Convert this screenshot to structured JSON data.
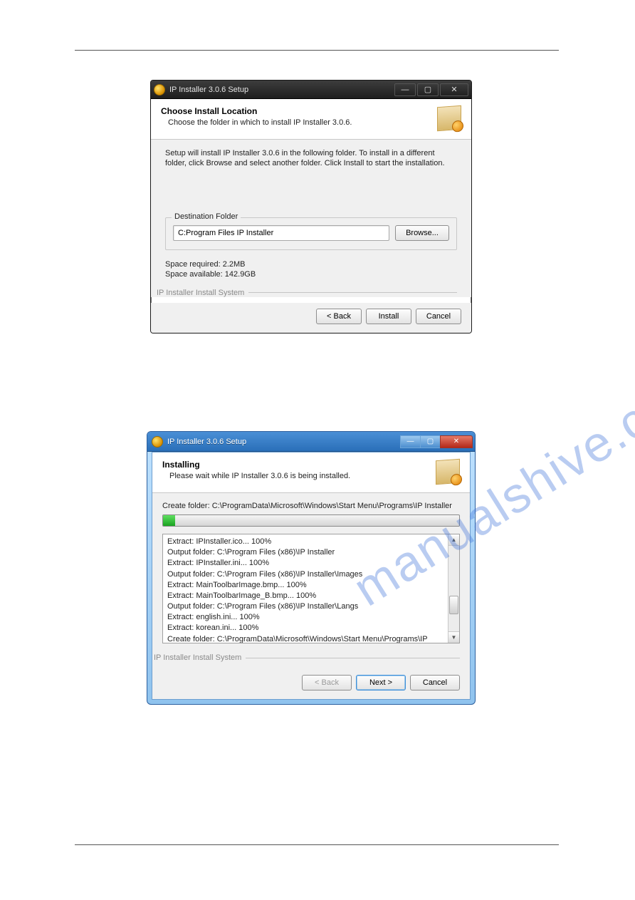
{
  "watermark": "manualshive.com",
  "dialog1": {
    "title": "IP Installer 3.0.6 Setup",
    "heading": "Choose Install Location",
    "subheading": "Choose the folder in which to install IP Installer 3.0.6.",
    "description": "Setup will install IP Installer 3.0.6 in the following folder. To install in a different folder, click Browse and select another folder. Click Install to start the installation.",
    "fieldset_label": "Destination Folder",
    "path_value": "C:Program Files IP Installer",
    "browse_label": "Browse...",
    "space_required": "Space required: 2.2MB",
    "space_available": "Space available: 142.9GB",
    "system_label": "IP Installer Install System",
    "back_label": "< Back",
    "install_label": "Install",
    "cancel_label": "Cancel",
    "win_min": "—",
    "win_max": "▢",
    "win_close": "✕"
  },
  "dialog2": {
    "title": "IP Installer 3.0.6 Setup",
    "heading": "Installing",
    "subheading": "Please wait while IP Installer 3.0.6 is being installed.",
    "current_action": "Create folder: C:\\ProgramData\\Microsoft\\Windows\\Start Menu\\Programs\\IP Installer",
    "progress_percent": 4,
    "log": [
      "Extract: IPInstaller.ico... 100%",
      "Output folder: C:\\Program Files (x86)\\IP Installer",
      "Extract: IPInstaller.ini... 100%",
      "Output folder: C:\\Program Files (x86)\\IP Installer\\Images",
      "Extract: MainToolbarImage.bmp... 100%",
      "Extract: MainToolbarImage_B.bmp... 100%",
      "Output folder: C:\\Program Files (x86)\\IP Installer\\Langs",
      "Extract: english.ini... 100%",
      "Extract: korean.ini... 100%",
      "Create folder: C:\\ProgramData\\Microsoft\\Windows\\Start Menu\\Programs\\IP Installer"
    ],
    "system_label": "IP Installer Install System",
    "back_label": "< Back",
    "next_label": "Next >",
    "cancel_label": "Cancel",
    "win_min": "—",
    "win_max": "▢",
    "win_close": "✕"
  }
}
